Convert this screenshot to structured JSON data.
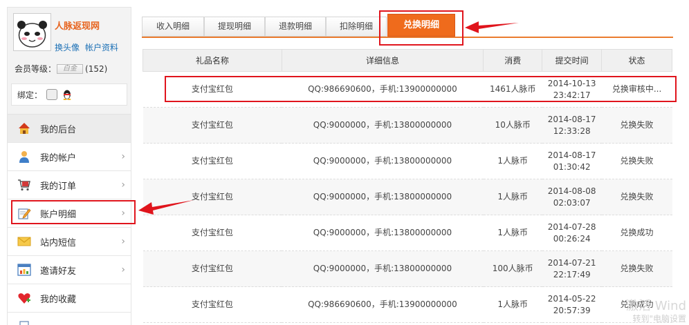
{
  "profile": {
    "site_name": "人脉返现网",
    "link_avatar": "换头像",
    "link_info": "帐户资料",
    "level_label": "会员等级：",
    "level_badge": "白金",
    "level_count": "(152)",
    "bind_label": "绑定："
  },
  "menu": [
    {
      "label": "我的后台",
      "icon": "home-icon",
      "chevron": false
    },
    {
      "label": "我的帐户",
      "icon": "user-icon",
      "chevron": true
    },
    {
      "label": "我的订单",
      "icon": "cart-icon",
      "chevron": true
    },
    {
      "label": "账户明细",
      "icon": "edit-icon",
      "chevron": true
    },
    {
      "label": "站内短信",
      "icon": "mail-icon",
      "chevron": true
    },
    {
      "label": "邀请好友",
      "icon": "chart-icon",
      "chevron": true
    },
    {
      "label": "我的收藏",
      "icon": "heart-icon",
      "chevron": false
    }
  ],
  "tabs": [
    "收入明细",
    "提现明细",
    "退款明细",
    "扣除明细",
    "兑换明细"
  ],
  "active_tab": 4,
  "table": {
    "headers": [
      "礼品名称",
      "详细信息",
      "消费",
      "提交时间",
      "状态"
    ],
    "rows": [
      {
        "name": "支付宝红包",
        "detail": "QQ:986690600，手机:13900000000",
        "cost": "1461人脉币",
        "date": "2014-10-13",
        "time": "23:42:17",
        "status": "兑换审核中...",
        "status_type": "pending"
      },
      {
        "name": "支付宝红包",
        "detail": "QQ:9000000，手机:13800000000",
        "cost": "10人脉币",
        "date": "2014-08-17",
        "time": "12:33:28",
        "status": "兑换失败",
        "status_type": "fail"
      },
      {
        "name": "支付宝红包",
        "detail": "QQ:9000000，手机:13800000000",
        "cost": "1人脉币",
        "date": "2014-08-17",
        "time": "01:30:42",
        "status": "兑换失败",
        "status_type": "fail"
      },
      {
        "name": "支付宝红包",
        "detail": "QQ:9000000，手机:13800000000",
        "cost": "1人脉币",
        "date": "2014-08-08",
        "time": "02:03:07",
        "status": "兑换失败",
        "status_type": "fail"
      },
      {
        "name": "支付宝红包",
        "detail": "QQ:9000000，手机:13800000000",
        "cost": "1人脉币",
        "date": "2014-07-28",
        "time": "00:26:24",
        "status": "兑换成功",
        "status_type": "ok"
      },
      {
        "name": "支付宝红包",
        "detail": "QQ:9000000，手机:13800000000",
        "cost": "100人脉币",
        "date": "2014-07-21",
        "time": "22:17:49",
        "status": "兑换失败",
        "status_type": "fail"
      },
      {
        "name": "支付宝红包",
        "detail": "QQ:986690600，手机:13900000000",
        "cost": "1人脉币",
        "date": "2014-05-22",
        "time": "20:57:39",
        "status": "兑换成功",
        "status_type": "ok"
      }
    ]
  },
  "watermark": {
    "line1": "激活 Wind",
    "line2": "转到\"电脑设置"
  },
  "colors": {
    "accent": "#ef6b1c",
    "annotation": "#e0141c",
    "success": "#35a61f",
    "pending": "#d3411c"
  }
}
